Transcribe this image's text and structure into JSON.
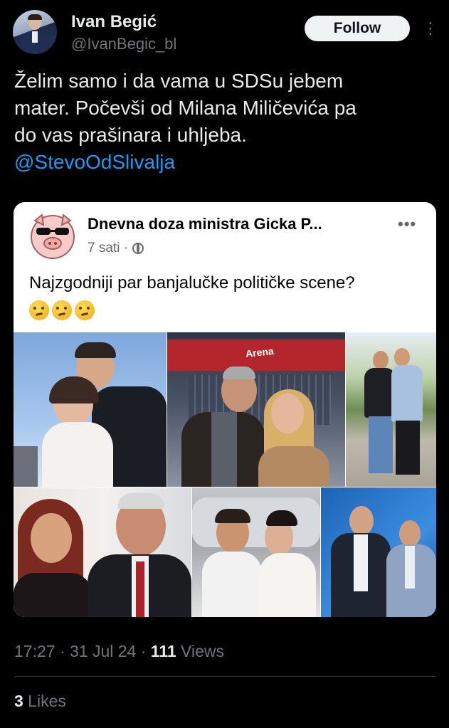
{
  "author": {
    "name": "Ivan Begić",
    "handle": "@IvanBegic_bl",
    "follow_label": "Follow",
    "more_icon": "ellipsis-vertical-icon"
  },
  "tweet": {
    "lines": [
      "Želim samo i da vama u SDSu jebem",
      "mater. Počevši od Milana Miličevića pa",
      "do vas prašinara i uhljeba."
    ],
    "mention": "@StevoOdSlivalja"
  },
  "embedded_post": {
    "page_name": "Dnevna doza ministra Gicka P...",
    "time": "7 sati ·",
    "caption": "Najzgodniji par banjalučke političke scene?",
    "emoji": [
      "🤔",
      "🤔",
      "🤔"
    ],
    "photo_collage_count": 6,
    "arena_sign": "Arena"
  },
  "meta": {
    "time": "17:27 · 31 Jul 24 · ",
    "views_count": "111",
    "views_label": " Views"
  },
  "likes": {
    "count": "3",
    "label": " Likes"
  },
  "colors": {
    "background": "#000000",
    "text": "#e7e9ea",
    "muted": "#71767b",
    "link": "#1d9bf0"
  }
}
